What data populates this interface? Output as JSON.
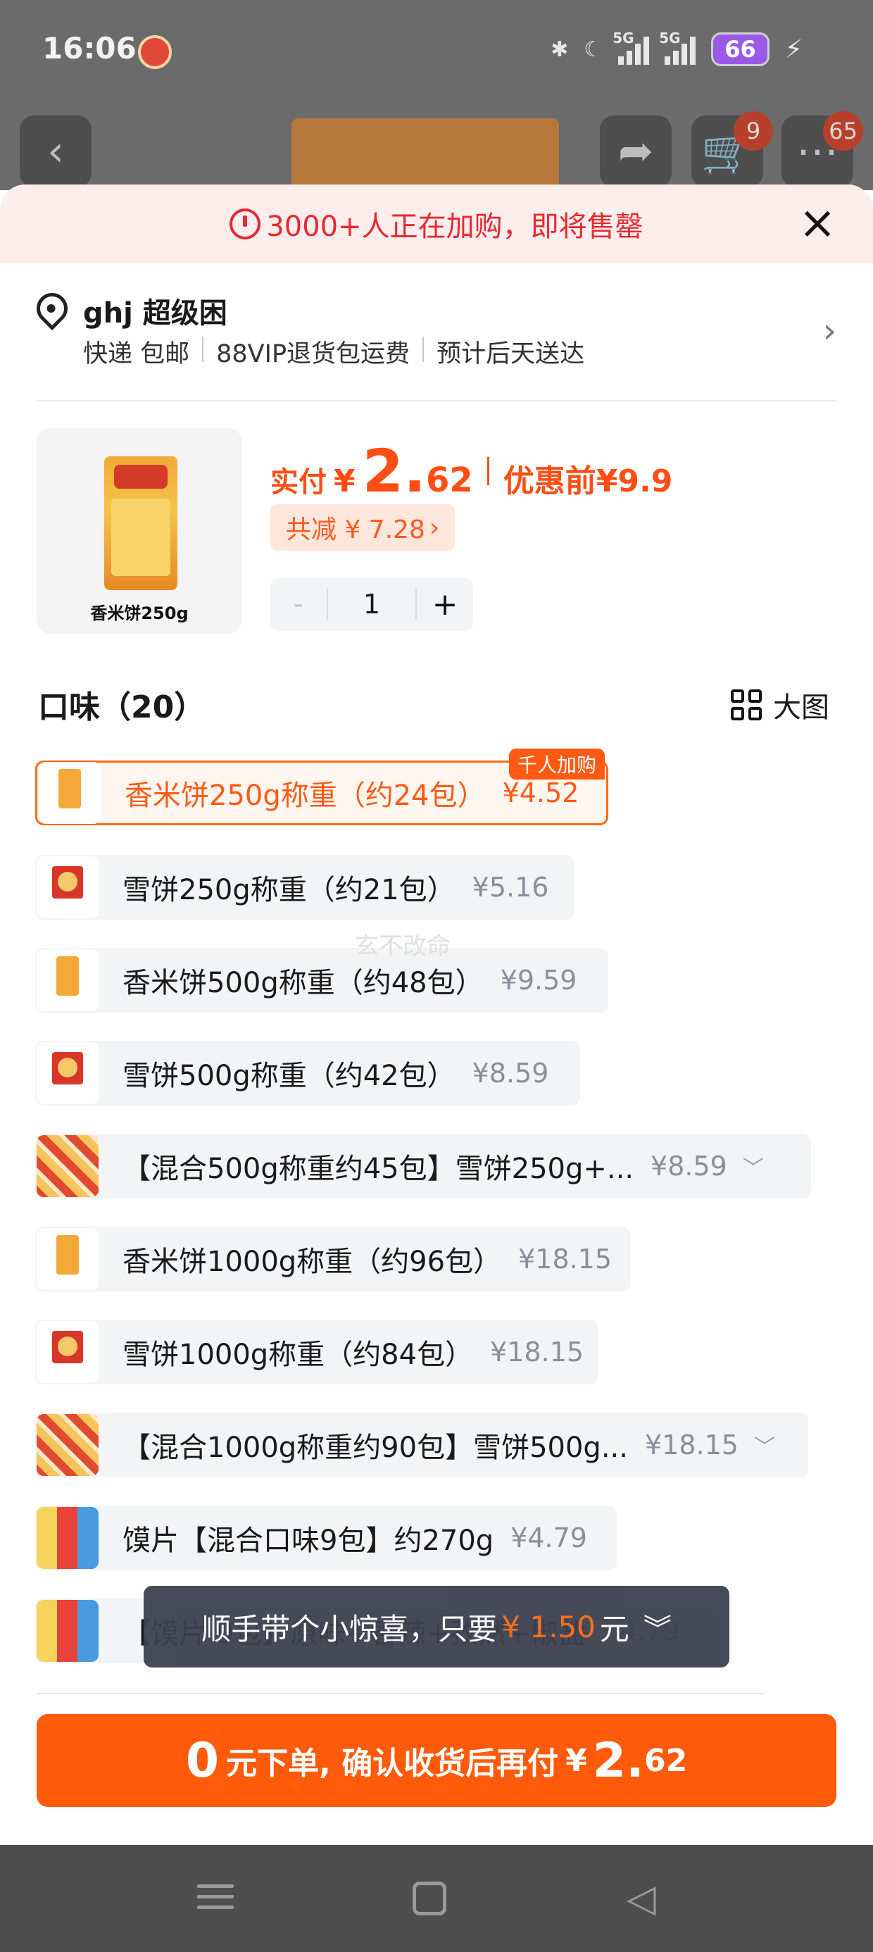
{
  "status_bar": {
    "time": "16:06",
    "network_1": "5G",
    "network_2": "5G",
    "battery": "66"
  },
  "top_nav": {
    "cart_count": "9",
    "more_count": "65"
  },
  "urgency": {
    "text": "3000+人正在加购，即将售罄",
    "close_icon": "close-icon"
  },
  "address": {
    "name": "ghj 超级困",
    "delivery": "快递 包邮",
    "return_policy": "88VIP退货包运费",
    "eta": "预计后天送达"
  },
  "product": {
    "thumb_caption": "香米饼250g",
    "price_label": "实付",
    "currency": "¥",
    "price_int": "2.",
    "price_dec": "62",
    "before_label": "优惠前",
    "before_price": "¥9.9",
    "discount": "共减 ¥ 7.28",
    "discount_chevron": "›",
    "quantity": "1",
    "minus": "-",
    "plus": "+"
  },
  "flavor": {
    "title": "口味（20）",
    "big_view_label": "大图"
  },
  "options": [
    {
      "label": "香米饼250g称重（约24包）",
      "price": "¥4.52",
      "badge": "千人加购",
      "selected": true
    },
    {
      "label": "雪饼250g称重（约21包）",
      "price": "¥5.16"
    },
    {
      "label": "香米饼500g称重（约48包）",
      "price": "¥9.59"
    },
    {
      "label": "雪饼500g称重（约42包）",
      "price": "¥8.59"
    },
    {
      "label": "【混合500g称重约45包】雪饼250g+...",
      "price": "¥8.59",
      "expandable": true
    },
    {
      "label": "香米饼1000g称重（约96包）",
      "price": "¥18.15"
    },
    {
      "label": "雪饼1000g称重（约84包）",
      "price": "¥18.15"
    },
    {
      "label": "【混合1000g称重约90包】雪饼500g...",
      "price": "¥18.15",
      "expandable": true
    },
    {
      "label": "馍片【混合口味9包】约270g",
      "price": "¥4.79"
    },
    {
      "label": "【馍片 9包】原味+香辣+孜然+椒盐",
      "price": "¥4.79"
    }
  ],
  "watermark": "玄不改命",
  "toast": {
    "prefix": "顺手带个小惊喜，只要",
    "amount": "¥ 1.50",
    "suffix": "元"
  },
  "cta": {
    "zero": "0",
    "text": "元下单, 确认收货后再付",
    "currency": "¥",
    "amount_int": "2.",
    "amount_dec": "62"
  },
  "colors": {
    "accent": "#ff5b0a",
    "urgent_red": "#e8282f",
    "option_bg": "#f3f4f6"
  }
}
